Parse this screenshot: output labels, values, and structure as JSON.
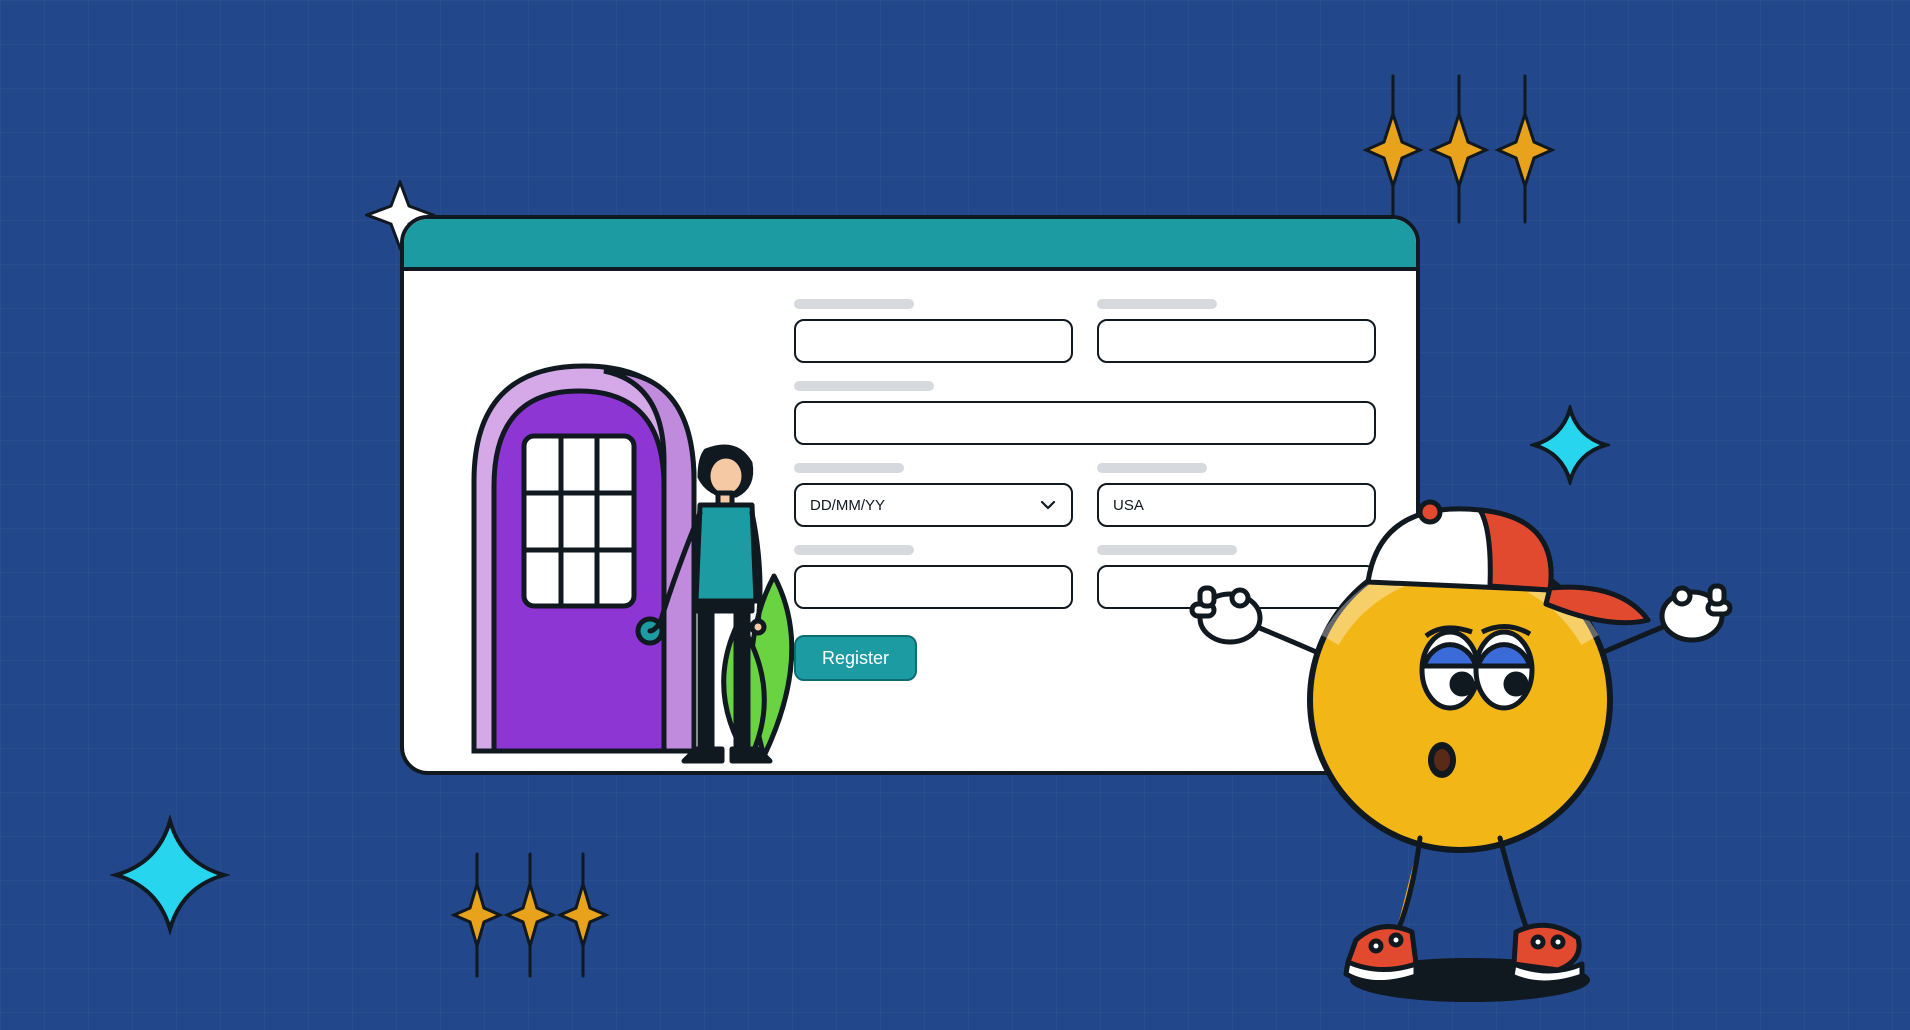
{
  "colors": {
    "bg": "#22478a",
    "accent": "#1c9ba3",
    "ink": "#101820",
    "orange": "#e8a21b",
    "cyan": "#27d6ee",
    "purple": "#8d36d3",
    "lilac": "#d5a8e8",
    "leaf": "#6ad342"
  },
  "form": {
    "row1_left_label": "",
    "row1_right_label": "",
    "row2_label": "",
    "date_placeholder": "DD/MM/YY",
    "country_value": "USA",
    "register_label": "Register"
  },
  "icons": {
    "chevron": "chevron-down-icon",
    "sparkle4_white": "sparkle-4pt-white-icon",
    "sparkle_cluster": "sparkle-cluster-icon",
    "diamond_cyan": "diamond-cyan-icon",
    "door_person": "door-person-illustration",
    "mascot": "mascot-character"
  }
}
